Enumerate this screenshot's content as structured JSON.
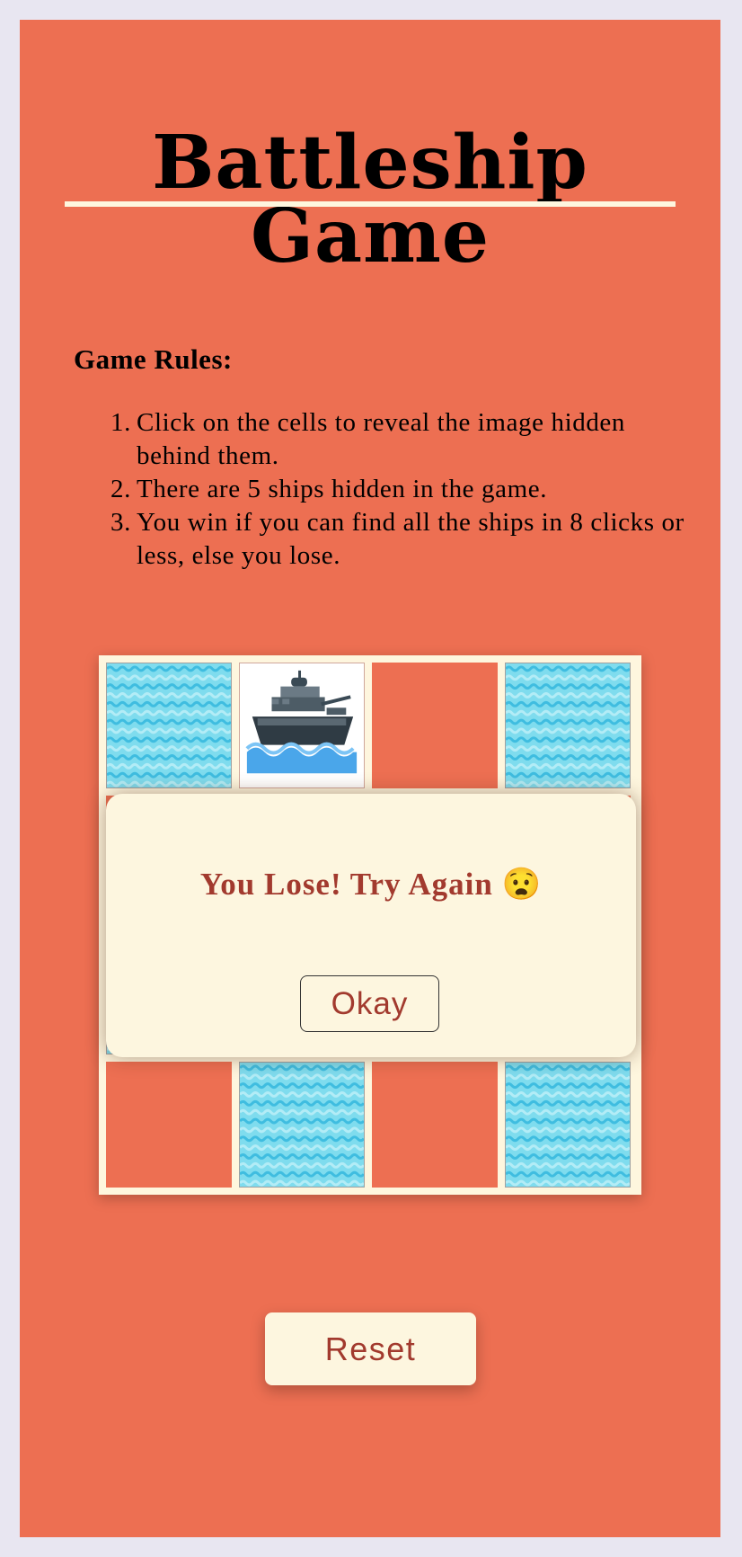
{
  "title": "Battleship Game",
  "rules": {
    "heading": "Game Rules:",
    "items": [
      {
        "num": "1.",
        "text": "Click on the cells to reveal the image hidden behind them."
      },
      {
        "num": "2.",
        "text": "There are 5 ships hidden in the game."
      },
      {
        "num": "3.",
        "text": "You win if you can find all the ships in 8 clicks or less, else you lose."
      }
    ]
  },
  "board": {
    "rows": 4,
    "cols": 4,
    "cells": [
      [
        "water",
        "ship",
        "hidden",
        "water"
      ],
      [
        "hidden",
        "unknown",
        "unknown",
        "hidden"
      ],
      [
        "water",
        "unknown",
        "unknown",
        "unknown"
      ],
      [
        "hidden",
        "water",
        "hidden",
        "water"
      ]
    ]
  },
  "modal": {
    "message": "You Lose! Try Again 😧",
    "ok_label": "Okay"
  },
  "reset_label": "Reset",
  "colors": {
    "page_bg": "#ed6f52",
    "cream": "#fef6de",
    "accent_text": "#a23a2e"
  }
}
